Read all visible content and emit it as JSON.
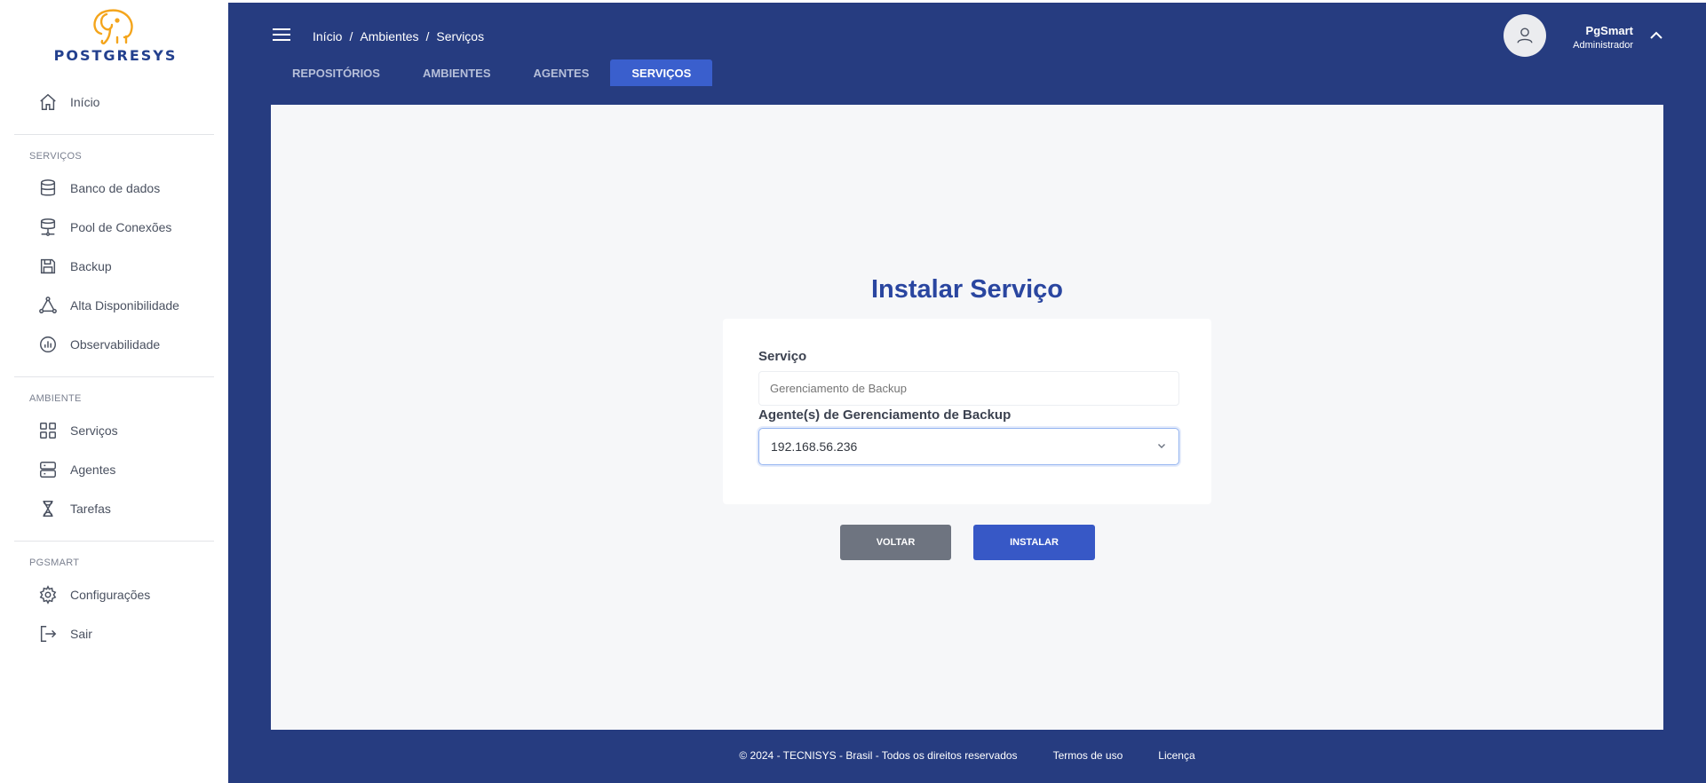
{
  "brand": {
    "logo_text": "POSTGRESYS"
  },
  "sidebar": {
    "home": {
      "label": "Início",
      "icon": "home-icon"
    },
    "sections": [
      {
        "title": "SERVIÇOS",
        "items": [
          {
            "label": "Banco de dados",
            "icon": "database-icon"
          },
          {
            "label": "Pool de Conexões",
            "icon": "connection-pool-icon"
          },
          {
            "label": "Backup",
            "icon": "save-icon"
          },
          {
            "label": "Alta Disponibilidade",
            "icon": "network-triangle-icon"
          },
          {
            "label": "Observabilidade",
            "icon": "chart-circle-icon"
          }
        ]
      },
      {
        "title": "AMBIENTE",
        "items": [
          {
            "label": "Serviços",
            "icon": "grid-icon"
          },
          {
            "label": "Agentes",
            "icon": "server-icon"
          },
          {
            "label": "Tarefas",
            "icon": "hourglass-icon"
          }
        ]
      },
      {
        "title": "PGSMART",
        "items": [
          {
            "label": "Configurações",
            "icon": "gear-icon"
          },
          {
            "label": "Sair",
            "icon": "logout-icon"
          }
        ]
      }
    ]
  },
  "header": {
    "breadcrumb": [
      "Início",
      "Ambientes",
      "Serviços"
    ],
    "separator": "/",
    "user": {
      "name": "PgSmart",
      "role": "Administrador"
    }
  },
  "tabs": [
    {
      "label": "REPOSITÓRIOS",
      "active": false
    },
    {
      "label": "AMBIENTES",
      "active": false
    },
    {
      "label": "AGENTES",
      "active": false
    },
    {
      "label": "SERVIÇOS",
      "active": true
    }
  ],
  "form": {
    "title": "Instalar Serviço",
    "service_label": "Serviço",
    "service_placeholder": "Gerenciamento de Backup",
    "agent_label": "Agente(s) de Gerenciamento de Backup",
    "agent_value": "192.168.56.236",
    "back_label": "VOLTAR",
    "install_label": "INSTALAR"
  },
  "footer": {
    "copyright": "© 2024 - TECNISYS - Brasil - Todos os direitos reservados",
    "terms": "Termos de uso",
    "license": "Licença"
  },
  "colors": {
    "primary_dark": "#263c80",
    "accent": "#3758c6",
    "title": "#2a46a0",
    "logo_orange": "#f4a51c"
  }
}
